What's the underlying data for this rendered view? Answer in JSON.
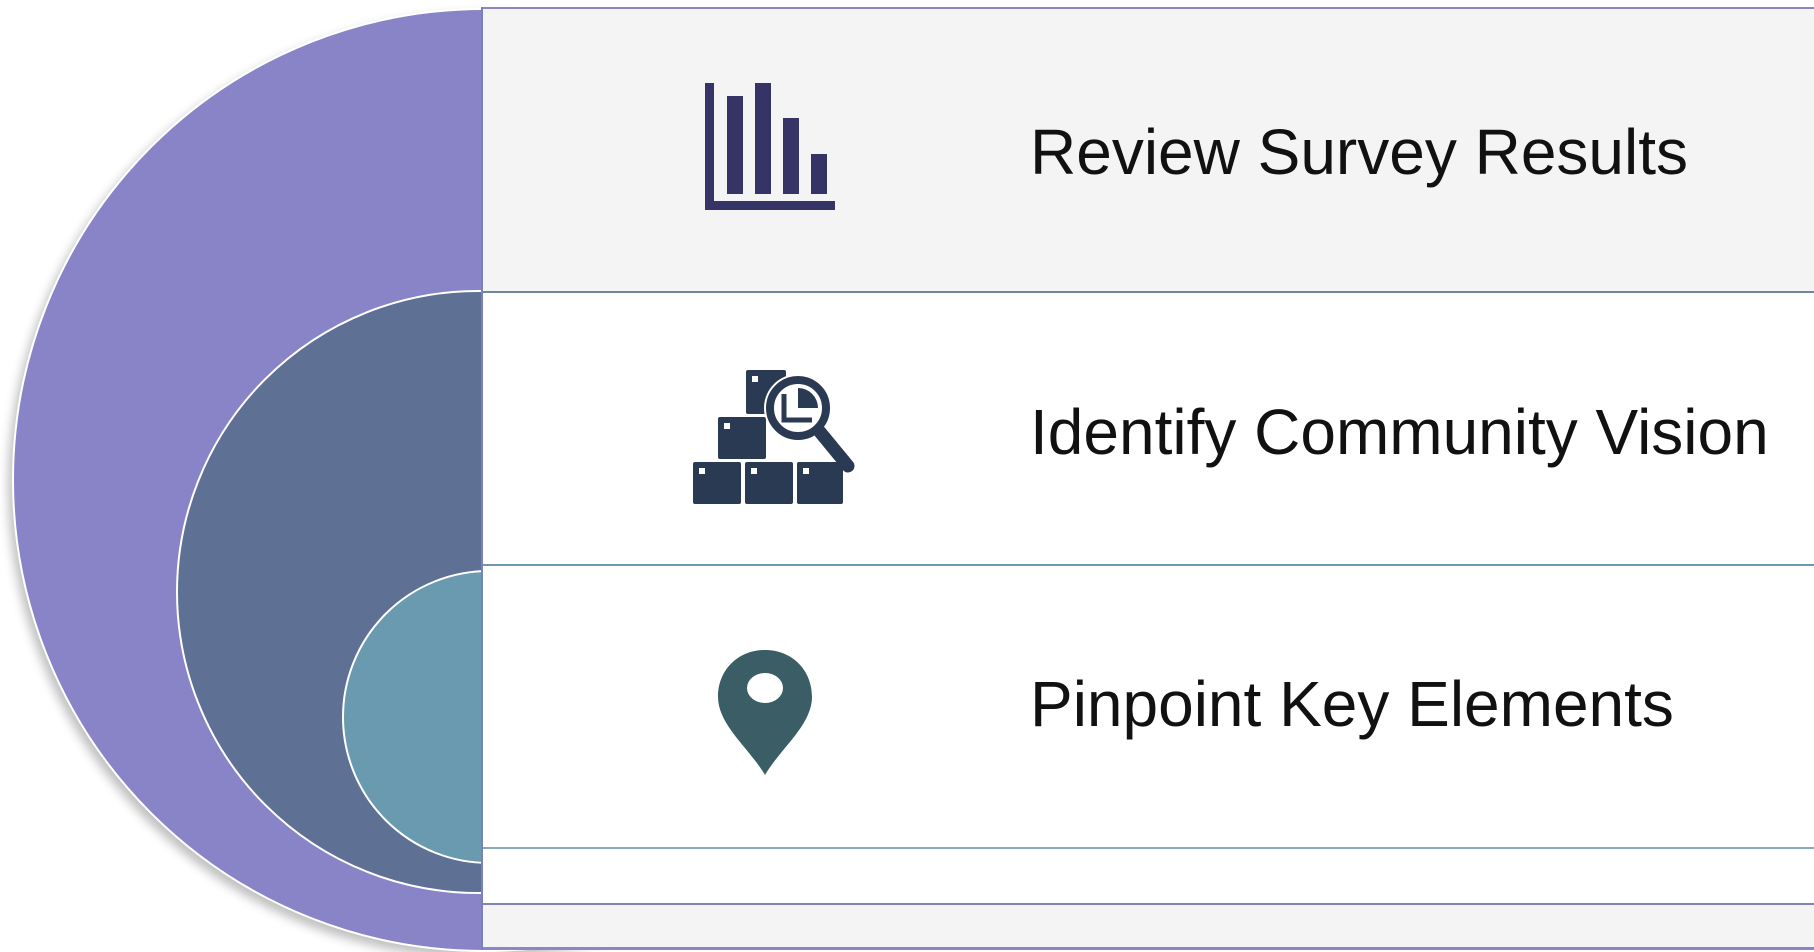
{
  "colors": {
    "outer_arc": "#8884c7",
    "middle_arc": "#5f7095",
    "inner_arc": "#6a9ab0",
    "icon_chart": "#363366",
    "icon_boxes": "#2a3a52",
    "icon_pin": "#3b5d66"
  },
  "steps": [
    {
      "label": "Review Survey Results",
      "icon": "bar-chart-icon"
    },
    {
      "label": "Identify Community Vision",
      "icon": "boxes-magnifier-icon"
    },
    {
      "label": "Pinpoint Key Elements",
      "icon": "map-pin-icon"
    }
  ]
}
